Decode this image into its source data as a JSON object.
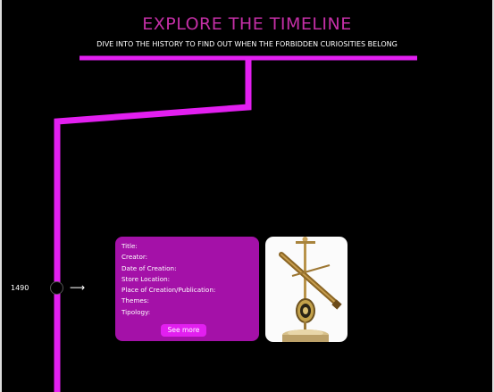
{
  "header": {
    "title": "EXPLORE THE TIMELINE",
    "subtitle": "DIVE INTO THE HISTORY TO FIND OUT WHEN THE FORBIDDEN CURIOSITIES BELONG"
  },
  "timeline": {
    "entries": [
      {
        "year": "1490",
        "fields": [
          "Title:",
          "Creator:",
          "Date of Creation:",
          "Store Location:",
          "Place of Creation/Publication:",
          "Themes:",
          "Tipology:"
        ],
        "button_label": "See more",
        "arrow": "⟶",
        "image_icon": "telescope-instrument-icon"
      }
    ]
  },
  "colors": {
    "accent": "#e21ff0",
    "card": "#a411a8",
    "title": "#c42fa6",
    "background": "#000000"
  }
}
